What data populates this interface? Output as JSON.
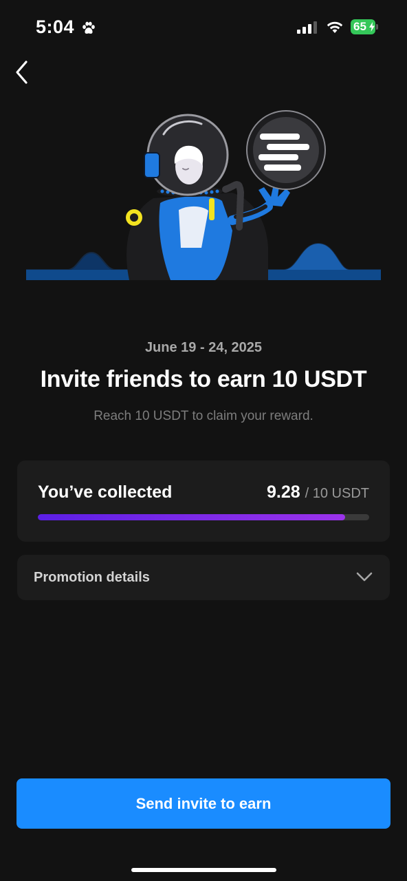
{
  "status_bar": {
    "time": "5:04",
    "battery_percent": "65",
    "icons": [
      "paw-icon",
      "signal-icon",
      "wifi-icon",
      "battery-icon"
    ]
  },
  "nav": {
    "back_icon": "chevron-left-icon"
  },
  "hero": {
    "illustration": "astronaut-holding-coin-illustration"
  },
  "promo": {
    "date_range": "June 19 - 24, 2025",
    "title": "Invite friends to earn 10 USDT",
    "subtitle": "Reach 10 USDT to claim your reward."
  },
  "progress_card": {
    "label": "You’ve collected",
    "collected": "9.28",
    "target": "/ 10 USDT",
    "progress_fraction": 0.928,
    "bar_color": "#6a24e8"
  },
  "details": {
    "label": "Promotion details",
    "icon": "chevron-down-icon"
  },
  "cta": {
    "label": "Send invite to earn",
    "color": "#1a8cff"
  }
}
